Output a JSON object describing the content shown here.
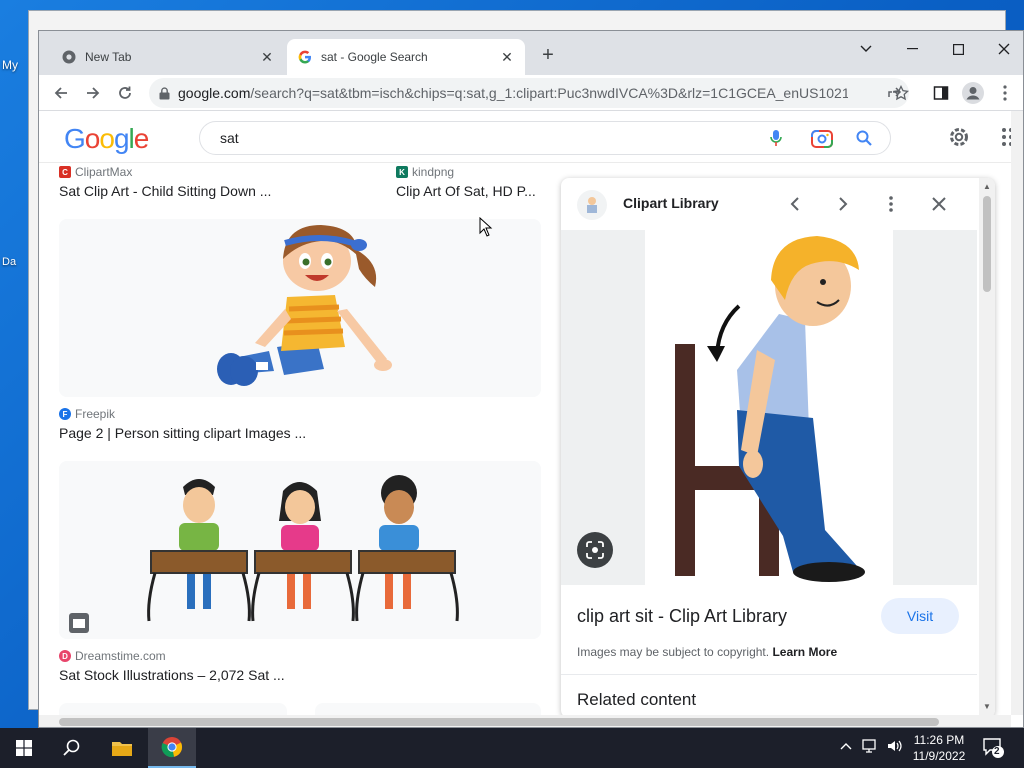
{
  "desktop": {
    "label_1": "My",
    "label_2": "Da"
  },
  "browser": {
    "tabs": [
      {
        "title": "New Tab"
      },
      {
        "title": "sat - Google Search"
      }
    ],
    "url_host": "google.com",
    "url_path": "/search?q=sat&tbm=isch&chips=q:sat,g_1:clipart:Puc3nwdIVCA%3D&rlz=1C1GCEA_enUS1021..."
  },
  "google": {
    "logo": [
      "G",
      "o",
      "o",
      "g",
      "l",
      "e"
    ],
    "logo_colors": [
      "#4285F4",
      "#EA4335",
      "#FBBC05",
      "#4285F4",
      "#34A853",
      "#EA4335"
    ],
    "query": "sat"
  },
  "results": [
    {
      "source": "ClipartMax",
      "title": "Sat Clip Art - Child Sitting Down ..."
    },
    {
      "source": "kindpng",
      "title": "Clip Art Of Sat, HD P..."
    },
    {
      "source": "Freepik",
      "title": "Page 2 | Person sitting clipart Images ..."
    },
    {
      "source": "Dreamstime.com",
      "title": "Sat Stock Illustrations – 2,072 Sat ..."
    }
  ],
  "panel": {
    "site": "Clipart Library",
    "caption": "clip art sit - Clip Art Library",
    "visit": "Visit",
    "copyright": "Images may be subject to copyright.",
    "learn_more": "Learn More",
    "related": "Related content"
  },
  "taskbar": {
    "time": "11:26 PM",
    "date": "11/9/2022",
    "notifications": "2"
  }
}
